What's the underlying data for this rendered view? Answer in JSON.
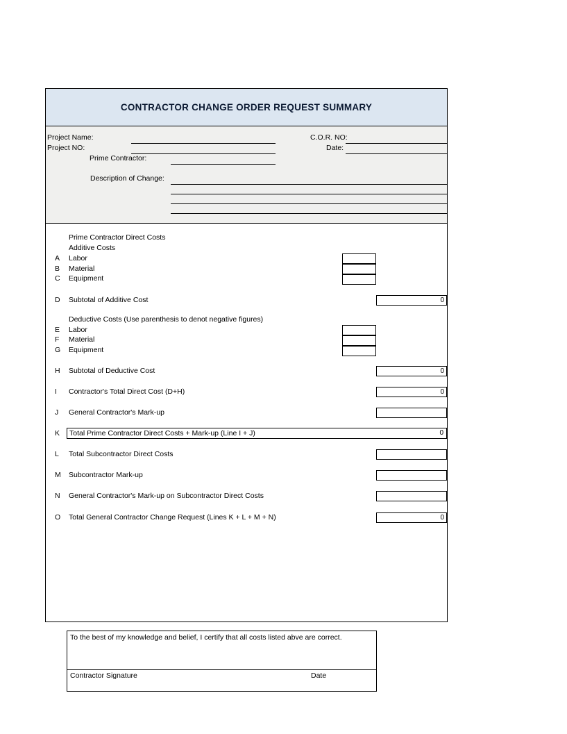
{
  "document": {
    "title": "CONTRACTOR CHANGE ORDER REQUEST SUMMARY"
  },
  "colors": {
    "title_banner_bg": "#dce6f1",
    "info_block_bg": "#f0f0ee",
    "border": "#000000",
    "title_text": "#0d1b33",
    "page_bg": "#ffffff"
  },
  "project_info": {
    "project_name_label": "Project Name:",
    "project_name_value": "",
    "project_no_label": "Project NO:",
    "project_no_value": "",
    "prime_contractor_label": "Prime Contractor:",
    "prime_contractor_value": "",
    "cor_no_label": "C.O.R. NO:",
    "cor_no_value": "",
    "date_label": "Date:",
    "date_value": "",
    "description_label": "Description of Change:",
    "description_lines": [
      "",
      "",
      "",
      ""
    ]
  },
  "cost_section": {
    "heading_direct_costs": "Prime Contractor Direct Costs",
    "heading_additive": "Additive Costs",
    "heading_deductive": "Deductive Costs (Use parenthesis to denot negative figures)",
    "additive_rows": [
      {
        "letter": "A",
        "label": "Labor",
        "value": ""
      },
      {
        "letter": "B",
        "label": "Material",
        "value": ""
      },
      {
        "letter": "C",
        "label": "Equipment",
        "value": ""
      }
    ],
    "additive_subtotal": {
      "letter": "D",
      "label": "Subtotal of Additive Cost",
      "value": "0"
    },
    "deductive_rows": [
      {
        "letter": "E",
        "label": "Labor",
        "value": ""
      },
      {
        "letter": "F",
        "label": "Material",
        "value": ""
      },
      {
        "letter": "G",
        "label": "Equipment",
        "value": ""
      }
    ],
    "deductive_subtotal": {
      "letter": "H",
      "label": "Subtotal of Deductive Cost",
      "value": "0"
    },
    "summary_rows": [
      {
        "letter": "I",
        "label": "Contractor's Total Direct Cost (D+H)",
        "value": "0"
      },
      {
        "letter": "J",
        "label": "General Contractor's Mark-up",
        "value": ""
      }
    ],
    "kline": {
      "letter": "K",
      "label": "Total Prime Contractor Direct Costs + Mark-up (Line I + J)",
      "value": "0"
    },
    "subcontractor_rows": [
      {
        "letter": "L",
        "label": "Total Subcontractor Direct Costs",
        "value": ""
      },
      {
        "letter": "M",
        "label": "Subcontractor Mark-up",
        "value": ""
      },
      {
        "letter": "N",
        "label": "General Contractor's Mark-up on Subcontractor Direct Costs",
        "value": ""
      },
      {
        "letter": "O",
        "label": "Total General Contractor Change Request (Lines K + L + M + N)",
        "value": "0"
      }
    ]
  },
  "certification": {
    "statement": "To the best of my knowledge and belief, I certify that all costs listed abve are correct.",
    "signature_label": "Contractor Signature",
    "date_label": "Date",
    "signature_value": "",
    "date_value": ""
  }
}
